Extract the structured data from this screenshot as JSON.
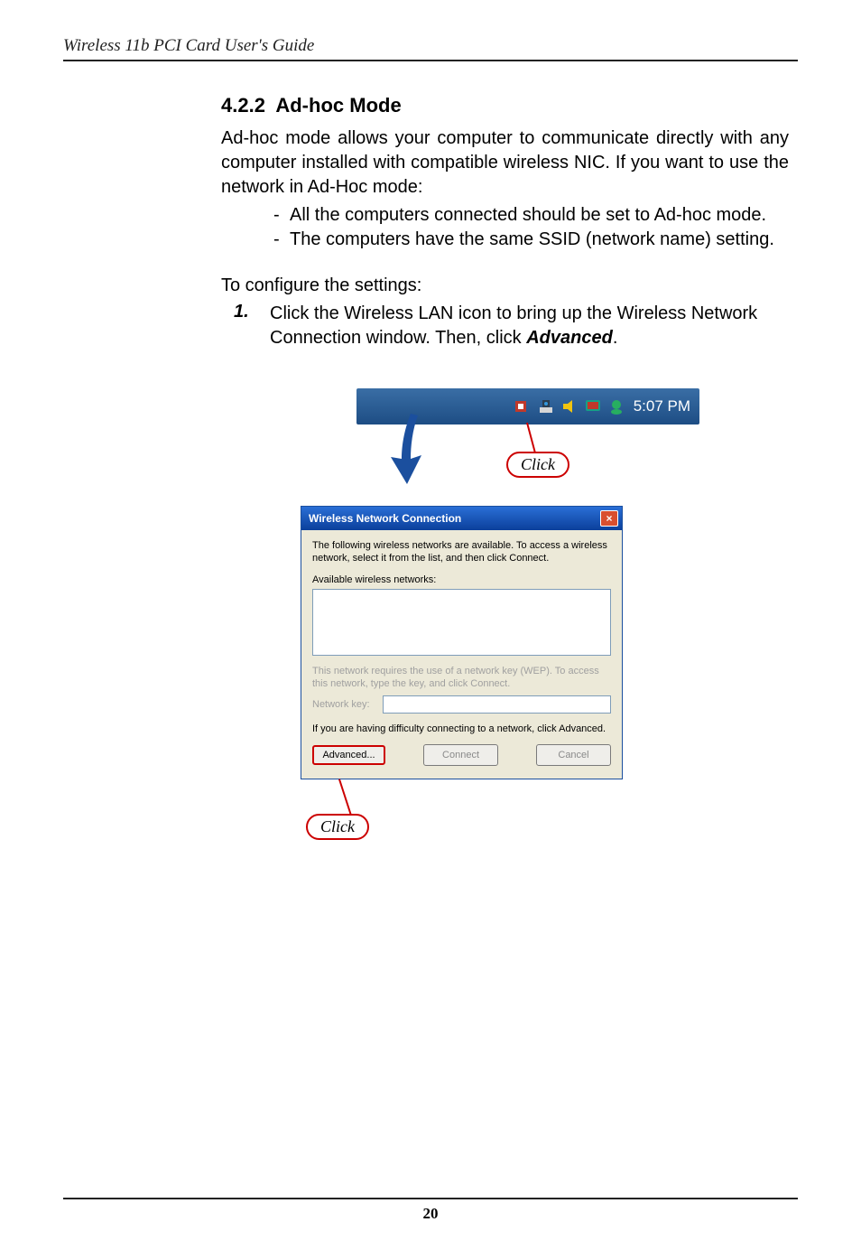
{
  "header": {
    "running_head": "Wireless 11b PCI Card User's Guide"
  },
  "section": {
    "number": "4.2.2",
    "title": "Ad-hoc Mode",
    "intro": "Ad-hoc mode allows your computer to communicate directly with any computer installed with compatible wireless NIC.  If you want to use the network in Ad-Hoc mode:",
    "bullets": [
      "All the computers connected should be set to Ad-hoc mode.",
      "The computers have the same SSID (network name) setting."
    ],
    "configure_lead": "To configure the settings:",
    "step_num": "1.",
    "step_pre": "Click the Wireless LAN icon to bring up the Wireless Network Connection window.  Then, click ",
    "step_bold": "Advanced",
    "step_post": "."
  },
  "tray": {
    "time": "5:07 PM",
    "icons": [
      "audio-icon",
      "lan-icon",
      "volume-icon",
      "display-icon",
      "msn-icon"
    ]
  },
  "annotation": {
    "click1": "Click",
    "click2": "Click"
  },
  "dialog": {
    "title": "Wireless Network Connection",
    "close": "×",
    "prompt": "The following wireless networks are available. To access a wireless network, select it from the list, and then click Connect.",
    "available_label": "Available wireless networks:",
    "wep_note": "This network requires the use of a network key (WEP). To access this network, type the key, and click Connect.",
    "key_label": "Network key:",
    "difficulty": "If you are having difficulty connecting to a network, click Advanced.",
    "buttons": {
      "advanced": "Advanced...",
      "connect": "Connect",
      "cancel": "Cancel"
    }
  },
  "footer": {
    "page": "20"
  }
}
